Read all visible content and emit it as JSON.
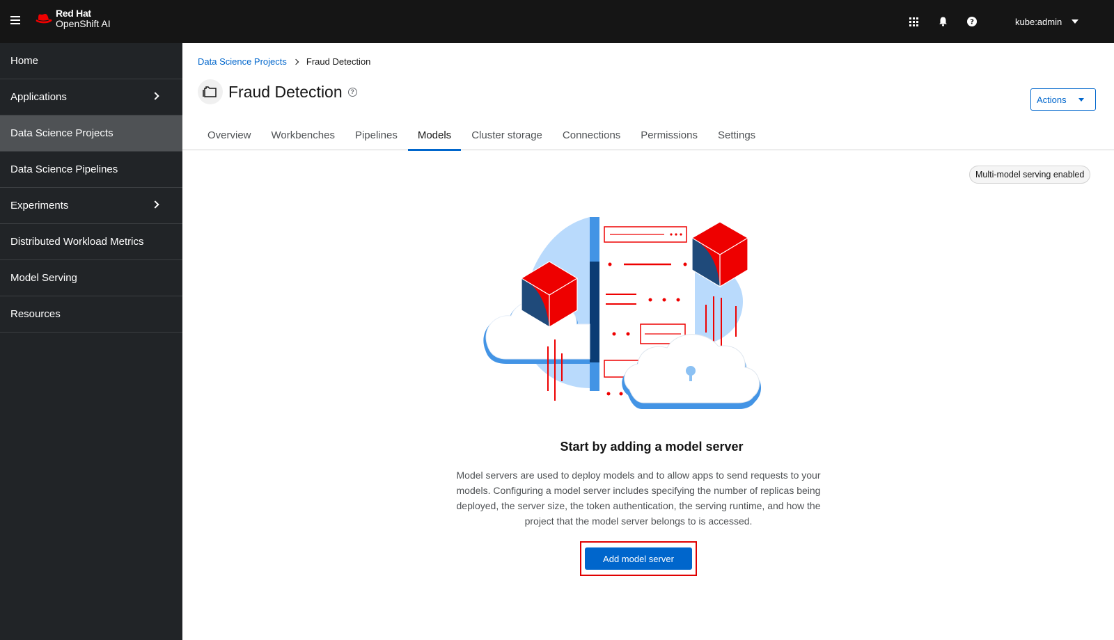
{
  "masthead": {
    "brand": "Red Hat",
    "product": "OpenShift AI",
    "user": "kube:admin"
  },
  "sidebar": {
    "items": [
      {
        "label": "Home"
      },
      {
        "label": "Applications"
      },
      {
        "label": "Data Science Projects"
      },
      {
        "label": "Data Science Pipelines"
      },
      {
        "label": "Experiments"
      },
      {
        "label": "Distributed Workload Metrics"
      },
      {
        "label": "Model Serving"
      },
      {
        "label": "Resources"
      }
    ]
  },
  "breadcrumb": {
    "parent": "Data Science Projects",
    "current": "Fraud Detection"
  },
  "page": {
    "title": "Fraud Detection",
    "help_glyph": "?",
    "actions_label": "Actions"
  },
  "tabs": [
    {
      "label": "Overview"
    },
    {
      "label": "Workbenches"
    },
    {
      "label": "Pipelines"
    },
    {
      "label": "Models"
    },
    {
      "label": "Cluster storage"
    },
    {
      "label": "Connections"
    },
    {
      "label": "Permissions"
    },
    {
      "label": "Settings"
    }
  ],
  "badge": "Multi-model serving enabled",
  "empty_state": {
    "title": "Start by adding a model server",
    "body": "Model servers are used to deploy models and to allow apps to send requests to your models. Configuring a model server includes specifying the number of replicas being deployed, the server size, the token authentication, the serving runtime, and how the project that the model server belongs to is accessed.",
    "button": "Add model server"
  },
  "colors": {
    "masthead": "#151515",
    "sidebar": "#212427",
    "active_nav": "#4f5255",
    "accent": "#0066cc",
    "red": "#ee0000"
  }
}
